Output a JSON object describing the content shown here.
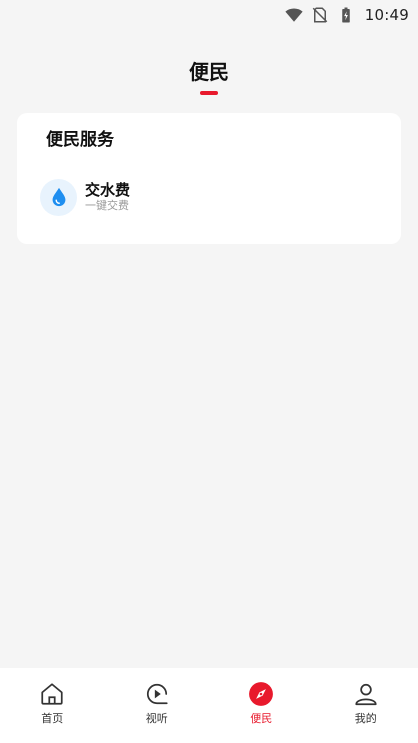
{
  "status_bar": {
    "time": "10:49",
    "icons": [
      "wifi-icon",
      "no-sim-icon",
      "battery-charging-icon"
    ]
  },
  "header": {
    "title": "便民"
  },
  "service_card": {
    "title": "便民服务",
    "items": [
      {
        "name": "交水费",
        "subtitle": "一键交费",
        "icon": "water-drop-icon"
      }
    ]
  },
  "tab_bar": {
    "tabs": [
      {
        "label": "首页",
        "icon": "home-icon",
        "active": false
      },
      {
        "label": "视听",
        "icon": "play-icon",
        "active": false
      },
      {
        "label": "便民",
        "icon": "compass-icon",
        "active": true
      },
      {
        "label": "我的",
        "icon": "user-icon",
        "active": false
      }
    ]
  },
  "colors": {
    "accent": "#e8192c",
    "water": "#1e8ef0",
    "background": "#f5f5f5"
  }
}
